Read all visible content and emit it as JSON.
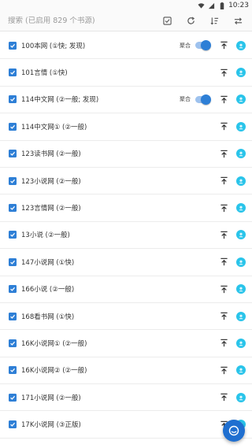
{
  "status": {
    "time": "10:23",
    "icons": [
      "wifi-icon",
      "signal-icon",
      "battery-icon"
    ]
  },
  "toolbar": {
    "search_placeholder": "搜索 (已启用 829 个书源)",
    "actions": [
      "select-all-icon",
      "refresh-icon",
      "sort-icon",
      "more-icon"
    ]
  },
  "aggregate_label": "聚合",
  "colors": {
    "accent": "#2e7fd6",
    "avatar": "#29c4ea",
    "fab": "#1f6fd0"
  },
  "sources": [
    {
      "label": "100本网 (①快; 发现)",
      "checked": true,
      "aggregate": true
    },
    {
      "label": "101言情 (①快)",
      "checked": true,
      "aggregate": false
    },
    {
      "label": "114中文网 (②一般; 发现)",
      "checked": true,
      "aggregate": true
    },
    {
      "label": "114中文网① (②一般)",
      "checked": true,
      "aggregate": false
    },
    {
      "label": "123读书网 (②一般)",
      "checked": true,
      "aggregate": false
    },
    {
      "label": "123小说网 (②一般)",
      "checked": true,
      "aggregate": false
    },
    {
      "label": "123言情网 (②一般)",
      "checked": true,
      "aggregate": false
    },
    {
      "label": "13小说 (②一般)",
      "checked": true,
      "aggregate": false
    },
    {
      "label": "147小说网 (①快)",
      "checked": true,
      "aggregate": false
    },
    {
      "label": "166小说 (②一般)",
      "checked": true,
      "aggregate": false
    },
    {
      "label": "168看书网 (①快)",
      "checked": true,
      "aggregate": false
    },
    {
      "label": "16K小说网① (②一般)",
      "checked": true,
      "aggregate": false
    },
    {
      "label": "16K小说网② (②一般)",
      "checked": true,
      "aggregate": false
    },
    {
      "label": "171小说网 (②一般)",
      "checked": true,
      "aggregate": false
    },
    {
      "label": "17K小说网 (③正版)",
      "checked": true,
      "aggregate": false
    }
  ]
}
